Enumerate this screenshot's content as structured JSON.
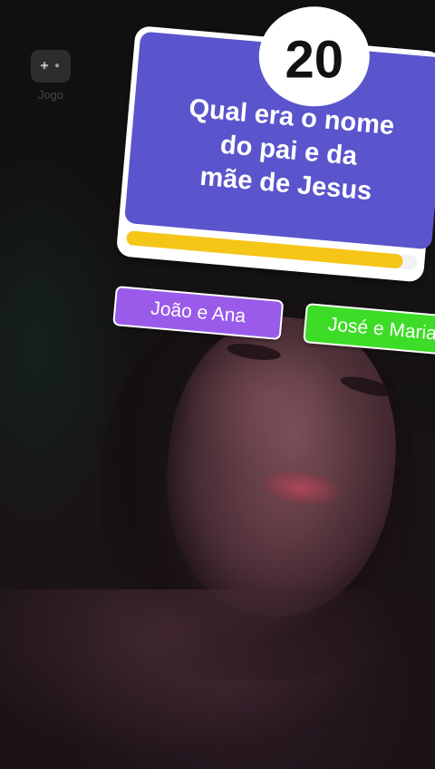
{
  "game_chip": {
    "label": "Jogo",
    "icon": "gamepad-icon"
  },
  "timer": {
    "value": "20",
    "progress_fraction": 0.95
  },
  "question": {
    "line1": "Qual era o nome",
    "line2": "do pai e da",
    "line3": "mãe de Jesus"
  },
  "answers": [
    {
      "label": "João e Ana",
      "color": "#9a5bea"
    },
    {
      "label": "José e Maria",
      "color": "#3ddc26"
    }
  ],
  "colors": {
    "card": "#5a55cc",
    "timer_bar": "#f5c518",
    "frame": "#ffffff"
  }
}
